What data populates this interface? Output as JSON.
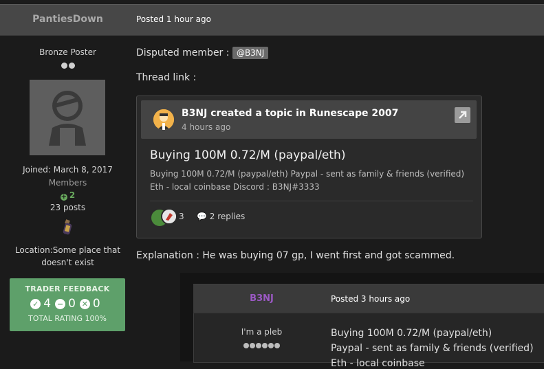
{
  "post": {
    "author": "PantiesDown",
    "posted": "Posted 1 hour ago",
    "rank": "Bronze Poster",
    "joined": "Joined: March 8, 2017",
    "group": "Members",
    "reputation": "2",
    "posts": "23 posts",
    "location_label": "Location:",
    "location_value": "Some place that doesn't exist"
  },
  "trader_feedback": {
    "title": "TRADER FEEDBACK",
    "positive": "4",
    "neutral": "0",
    "negative": "0",
    "total": "TOTAL RATING 100%"
  },
  "content": {
    "disputed_label": "Disputed member :",
    "disputed_mention": "@B3NJ",
    "thread_link_label": "Thread link :",
    "explanation": "Explanation : He was buying 07 gp, I went first and got scammed."
  },
  "embed": {
    "headline": "B3NJ created a topic in Runescape 2007",
    "time": "4 hours ago",
    "title": "Buying 100M 0.72/M (paypal/eth)",
    "body": "Buying 100M 0.72/M (paypal/eth) Paypal - sent as family & friends (verified) Eth - local coinbase Discord : B3NJ#3333",
    "reaction_count": "3",
    "replies": "2 replies"
  },
  "quoted_post": {
    "author": "B3NJ",
    "posted": "Posted 3 hours ago",
    "rank": "I'm a pleb",
    "line1": "Buying 100M 0.72/M (paypal/eth)",
    "line2": "Paypal - sent as family & friends (verified)",
    "line3": "Eth - local coinbase"
  },
  "colors": {
    "accent_green": "#5ea06a",
    "author_purple": "#9b59c4"
  }
}
